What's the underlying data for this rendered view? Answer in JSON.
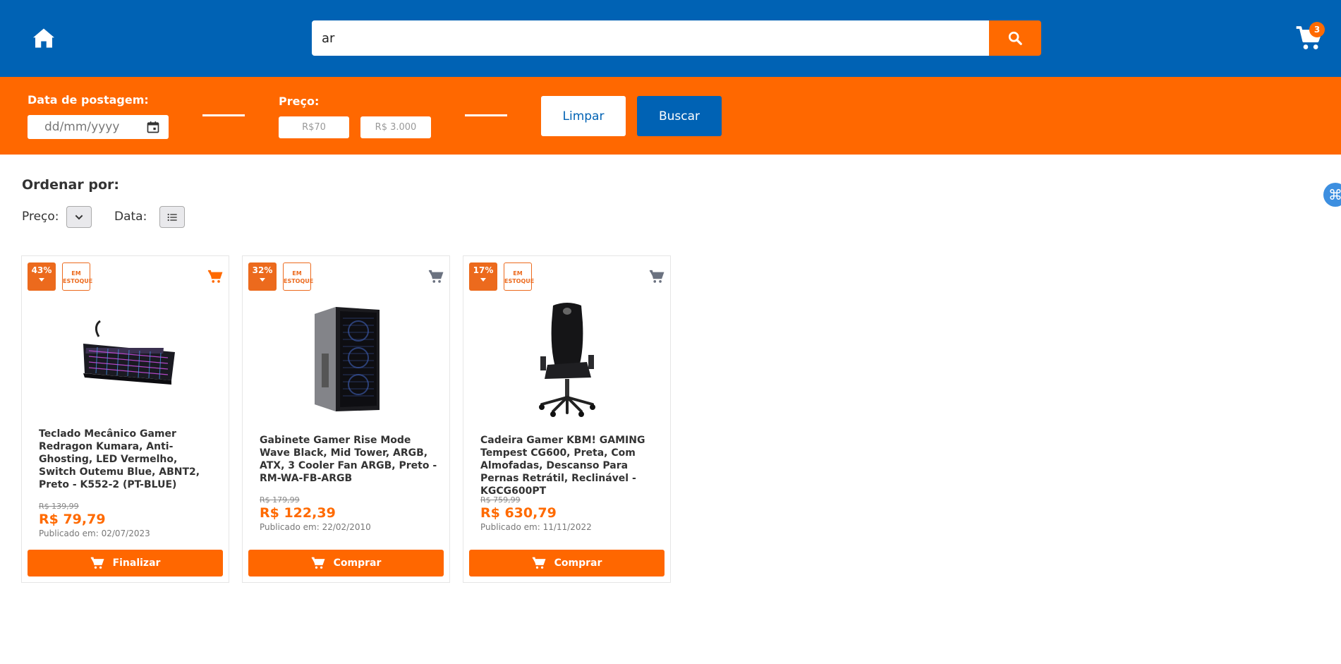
{
  "header": {
    "search_value": "ar",
    "cart_count": "3"
  },
  "filters": {
    "date_label": "Data de postagem:",
    "date_placeholder": "dd/mm/yyyy",
    "price_label": "Preço:",
    "price_min_placeholder": "R$70",
    "price_max_placeholder": "R$ 3.000",
    "clear_label": "Limpar",
    "search_label": "Buscar"
  },
  "sort": {
    "title": "Ordenar por:",
    "price_label": "Preço:",
    "date_label": "Data:"
  },
  "colors": {
    "primary": "#0062b4",
    "accent": "#ff6800"
  },
  "products": [
    {
      "discount": "43%",
      "stock": "EM ESTOQUE",
      "title": "Teclado Mecânico Gamer Redragon Kumara, Anti-Ghosting, LED Vermelho, Switch Outemu Blue, ABNT2, Preto - K552-2 (PT-BLUE)",
      "old_price": "R$ 139,99",
      "price": "R$ 79,79",
      "published": "Publicado em: 02/07/2023",
      "button": "Finalizar",
      "image": "keyboard"
    },
    {
      "discount": "32%",
      "stock": "EM ESTOQUE",
      "title": "Gabinete Gamer Rise Mode Wave Black, Mid Tower, ARGB, ATX, 3 Cooler Fan ARGB, Preto - RM-WA-FB-ARGB",
      "old_price": "R$ 179,99",
      "price": "R$ 122,39",
      "published": "Publicado em: 22/02/2010",
      "button": "Comprar",
      "image": "pc-case"
    },
    {
      "discount": "17%",
      "stock": "EM ESTOQUE",
      "title": "Cadeira Gamer KBM! GAMING Tempest CG600, Preta, Com Almofadas, Descanso Para Pernas Retrátil, Reclinável - KGCG600PT",
      "old_price": "R$ 759,99",
      "price": "R$ 630,79",
      "published": "Publicado em: 11/11/2022",
      "button": "Comprar",
      "image": "gaming-chair"
    }
  ]
}
